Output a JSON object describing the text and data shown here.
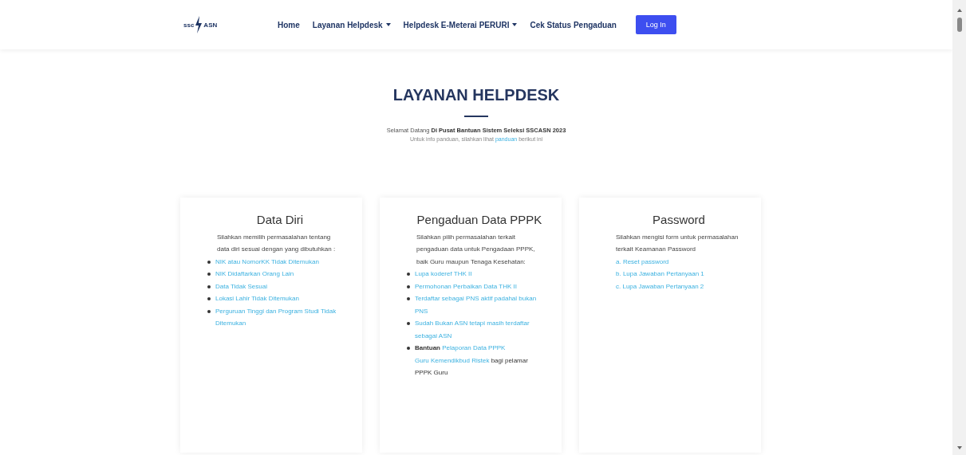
{
  "navbar": {
    "logo": {
      "left": "ssc",
      "right": "ASN"
    },
    "items": [
      {
        "label": "Home",
        "dropdown": false
      },
      {
        "label": "Layanan Helpdesk",
        "dropdown": true
      },
      {
        "label": "Helpdesk E-Meterai PERURI",
        "dropdown": true
      },
      {
        "label": "Cek Status Pengaduan",
        "dropdown": false
      }
    ],
    "login_button": "Log In"
  },
  "header": {
    "title": "LAYANAN HELPDESK",
    "subtitle": "Selamat Datang **Di Pusat Bantuan Sistem Seleksi SSCASN 2023**",
    "note": [
      {
        "text": "Untuk info panduan, silahkan lihat ",
        "link": false
      },
      {
        "text": "panduan",
        "link": true
      },
      {
        "text": " berikut ini",
        "link": false
      }
    ]
  },
  "cards": [
    {
      "title": "Data Diri",
      "description": "Silahkan memilih permasalahan tentang data diri sesuai dengan yang dibutuhkan :",
      "kind": "bullets",
      "items": [
        [
          {
            "text": "NIK atau NomorKK Tidak Ditemukan",
            "link": true
          }
        ],
        [
          {
            "text": "NIK Didaftarkan Orang Lain",
            "link": true
          }
        ],
        [
          {
            "text": "Data Tidak Sesuai",
            "link": true
          }
        ],
        [
          {
            "text": "Lokasi Lahir Tidak Ditemukan",
            "link": true
          }
        ],
        [
          {
            "text": "Perguruan Tinggi dan Program Studi Tidak Ditemukan",
            "link": true
          }
        ]
      ]
    },
    {
      "title": "Pengaduan Data PPPK",
      "description": "Silahkan pilih permasalahan terkait pengaduan data untuk Pengadaan PPPK, baik Guru maupun Tenaga Kesehatan:",
      "kind": "bullets",
      "items": [
        [
          {
            "text": "Lupa koderef THK II",
            "link": true
          }
        ],
        [
          {
            "text": "Permohonan Perbaikan Data THK II",
            "link": true
          }
        ],
        [
          {
            "text": "Terdaftar sebagai PNS aktif padahal bukan PNS",
            "link": true
          }
        ],
        [
          {
            "text": "Sudah Bukan ASN tetapi masih terdaftar sebagai ASN",
            "link": true
          }
        ],
        [
          {
            "text": "Bantuan",
            "link": false
          },
          {
            "text": "Pelaporan Data PPPK",
            "link": true
          },
          {
            "text": "Guru Kemendikbud Ristek",
            "link": true
          },
          {
            "text": "bagi pelamar PPPK Guru",
            "link": false
          }
        ]
      ]
    },
    {
      "title": "Password",
      "description": "Silahkan mengisi form untuk permasalahan terkait Keamanan Password",
      "kind": "lettered",
      "items": [
        [
          {
            "text": "a. Reset password",
            "link": true
          }
        ],
        [
          {
            "text": "b. Lupa Jawaban Pertanyaan 1",
            "link": true
          }
        ],
        [
          {
            "text": "c. Lupa Jawaban Pertanyaan 2",
            "link": true
          }
        ]
      ]
    }
  ]
}
